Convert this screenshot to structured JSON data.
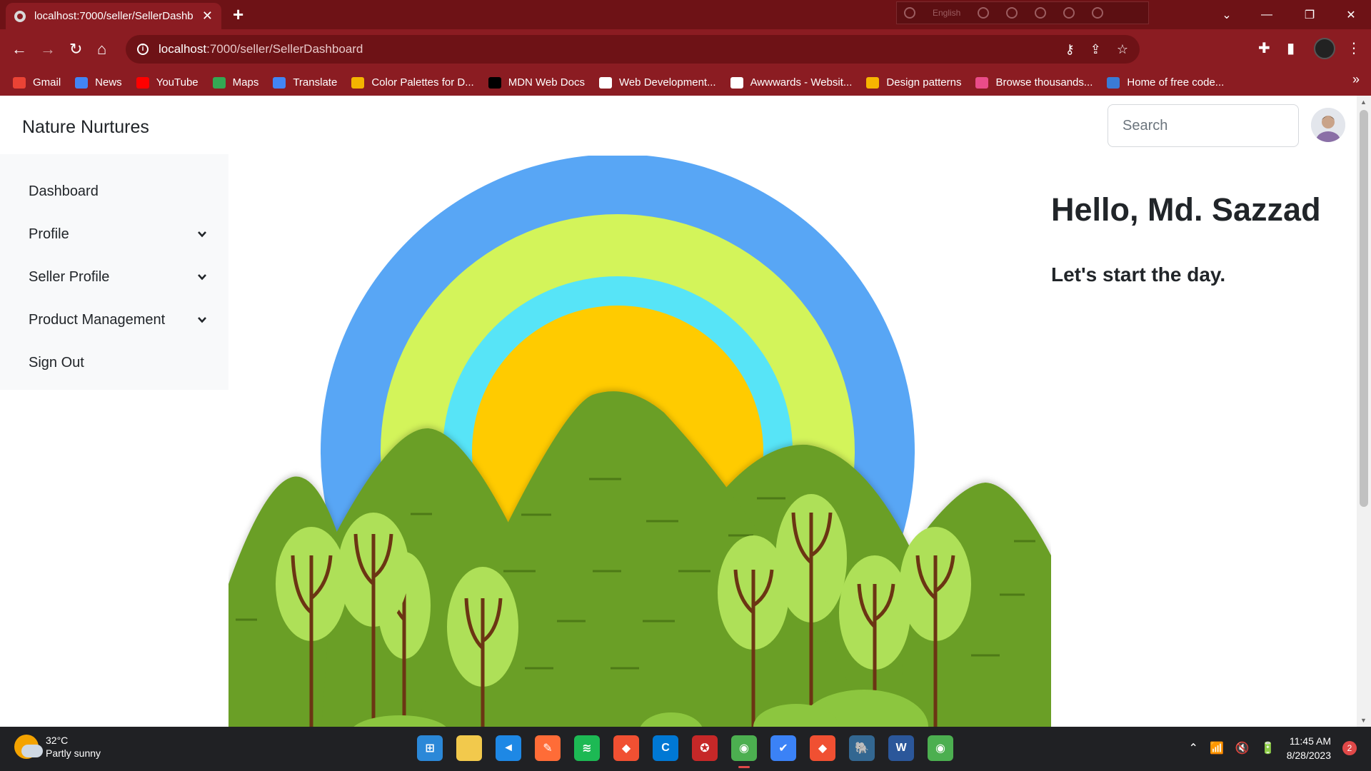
{
  "browser": {
    "tab_title": "localhost:7000/seller/SellerDashb",
    "new_tab_label": "+",
    "close_tab_label": "✕",
    "extension_language": "English",
    "url_host": "localhost",
    "url_path": ":7000/seller/SellerDashboard",
    "window_controls": {
      "dropdown": "⌄",
      "minimize": "—",
      "restore": "❐",
      "close": "✕"
    }
  },
  "bookmarks": [
    {
      "label": "Gmail",
      "color": "#ea4335"
    },
    {
      "label": "News",
      "color": "#4285f4"
    },
    {
      "label": "YouTube",
      "color": "#ff0000"
    },
    {
      "label": "Maps",
      "color": "#34a853"
    },
    {
      "label": "Translate",
      "color": "#4285f4"
    },
    {
      "label": "Color Palettes for D...",
      "color": "#f4b400"
    },
    {
      "label": "MDN Web Docs",
      "color": "#000000"
    },
    {
      "label": "Web Development...",
      "color": "#ffffff"
    },
    {
      "label": "Awwwards - Websit...",
      "color": "#ffffff"
    },
    {
      "label": "Design patterns",
      "color": "#f7b500"
    },
    {
      "label": "Browse thousands...",
      "color": "#ea4c89"
    },
    {
      "label": "Home of free code...",
      "color": "#3a7bd5"
    }
  ],
  "bookmarks_more": "»",
  "app": {
    "brand": "Nature Nurtures",
    "search_placeholder": "Search",
    "greeting": "Hello, Md. Sazzad",
    "subtitle": "Let's start the day.",
    "sidebar": [
      {
        "label": "Dashboard",
        "has_dropdown": false
      },
      {
        "label": "Profile",
        "has_dropdown": true
      },
      {
        "label": "Seller Profile",
        "has_dropdown": true
      },
      {
        "label": "Product Management",
        "has_dropdown": true
      },
      {
        "label": "Sign Out",
        "has_dropdown": false
      }
    ]
  },
  "taskbar": {
    "temperature": "32°C",
    "weather": "Partly sunny",
    "time": "11:45 AM",
    "date": "8/28/2023",
    "notifications": "2",
    "apps": [
      {
        "name": "start",
        "color": "#2b88d8",
        "glyph": "⊞"
      },
      {
        "name": "file-explorer",
        "color": "#f2c94c",
        "glyph": ""
      },
      {
        "name": "vscode",
        "color": "#1e88e5",
        "glyph": "◄"
      },
      {
        "name": "postman",
        "color": "#ff6c37",
        "glyph": "✎"
      },
      {
        "name": "spotify",
        "color": "#1db954",
        "glyph": "≋"
      },
      {
        "name": "git",
        "color": "#f05032",
        "glyph": "◆"
      },
      {
        "name": "c-app",
        "color": "#0078d4",
        "glyph": "C"
      },
      {
        "name": "red-app",
        "color": "#c62828",
        "glyph": "✪"
      },
      {
        "name": "chrome",
        "color": "#4caf50",
        "glyph": "◉"
      },
      {
        "name": "todo",
        "color": "#3b82f6",
        "glyph": "✔"
      },
      {
        "name": "git-2",
        "color": "#f05032",
        "glyph": "◆"
      },
      {
        "name": "postgres",
        "color": "#336791",
        "glyph": "🐘"
      },
      {
        "name": "word",
        "color": "#2b579a",
        "glyph": "W"
      },
      {
        "name": "chrome-2",
        "color": "#4caf50",
        "glyph": "◉"
      }
    ]
  }
}
